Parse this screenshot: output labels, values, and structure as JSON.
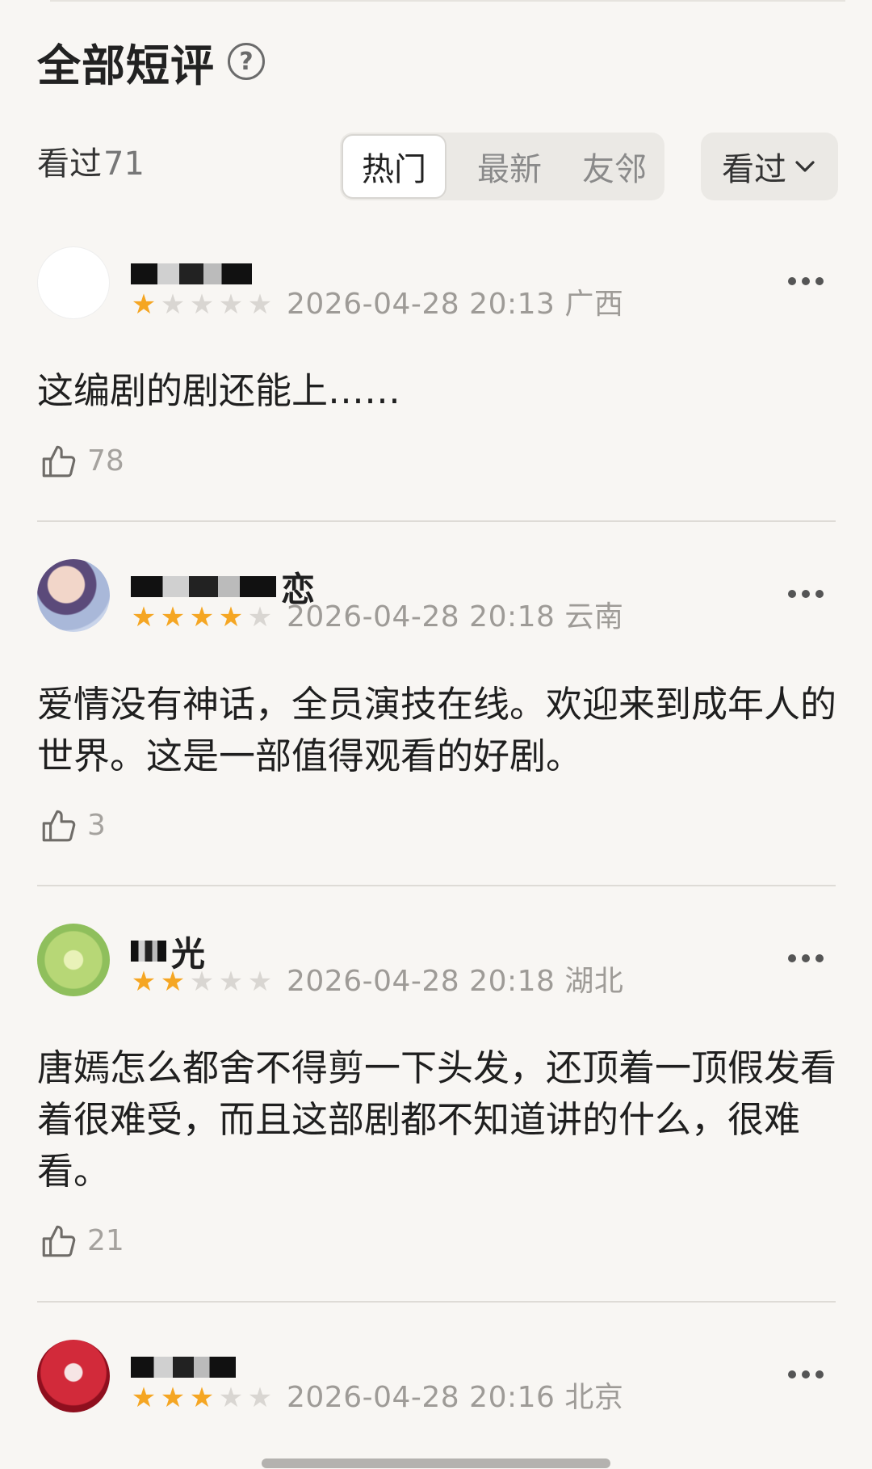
{
  "header": {
    "title": "全部短评",
    "help_glyph": "?"
  },
  "summary": {
    "watched_label": "看过",
    "watched_count": "71"
  },
  "tabs": [
    {
      "label": "热门",
      "active": true
    },
    {
      "label": "最新",
      "active": false
    },
    {
      "label": "友邻",
      "active": false
    }
  ],
  "filter": {
    "label": "看过"
  },
  "reviews": [
    {
      "username_visible": "",
      "rating": 1,
      "date": "2026-04-28 20:13",
      "location": "广西",
      "text": "这编剧的剧还能上……",
      "likes": "78"
    },
    {
      "username_visible": "恋",
      "rating": 4,
      "date": "2026-04-28 20:18",
      "location": "云南",
      "text": "爱情没有神话，全员演技在线。欢迎来到成年人的世界。这是一部值得观看的好剧。",
      "likes": "3"
    },
    {
      "username_visible": "光",
      "rating": 2,
      "date": "2026-04-28 20:18",
      "location": "湖北",
      "text": "唐嫣怎么都舍不得剪一下头发，还顶着一顶假发看着很难受，而且这部剧都不知道讲的什么，很难看。",
      "likes": "21"
    },
    {
      "username_visible": "",
      "rating": 3,
      "date": "2026-04-28 20:16",
      "location": "北京",
      "text": "",
      "likes": ""
    }
  ],
  "icons": {
    "star_on_color": "#f5a623",
    "star_off_color": "#d9d6d2",
    "more": "more-dots-icon",
    "like": "thumbs-up-icon",
    "help": "help-circle-icon",
    "chevron": "chevron-down-icon"
  }
}
